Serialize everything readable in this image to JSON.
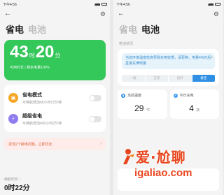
{
  "left": {
    "status": {
      "time": "下午4:56"
    },
    "tabs": [
      "省电",
      "电池"
    ],
    "battery": {
      "hours": "43",
      "h_unit": "时",
      "minutes": "20",
      "m_unit": "分",
      "sub": "可用时长 | 剩余电量100%"
    },
    "modes": [
      {
        "title": "省电模式",
        "desc": "可续航增加66小时15分钟"
      },
      {
        "title": "超级省电",
        "desc": "可续航增加400小时2分钟"
      }
    ],
    "tip": {
      "text": "发现2个耗电问题，立即优化",
      "arrow": "›"
    },
    "bottom": {
      "label": "续航时长 ›",
      "value": "0时22分"
    }
  },
  "right": {
    "status": {
      "time": "下午4:56"
    },
    "tabs": [
      "省电",
      "电池"
    ],
    "section_label": "电池状况",
    "notice": {
      "text": "当前环境温度较高导致充电较慢，请更换，电量4%时后直接充满电量",
      "close": "×"
    },
    "segments": [
      "一般",
      "正常",
      "良好",
      "极佳"
    ],
    "active_segment": 3,
    "stats": [
      {
        "label": "当前温度",
        "value": "29",
        "unit": "℃"
      },
      {
        "label": "今日充电",
        "value": "4",
        "unit": "次"
      }
    ]
  },
  "watermark": {
    "line1": "爱·尬聊",
    "line2": "igaliao.com"
  },
  "colors": {
    "green": "#34c759",
    "blue": "#2f8fe5",
    "orange": "#f5a623",
    "purple": "#8e7cf0",
    "brand": "#e8461e"
  }
}
